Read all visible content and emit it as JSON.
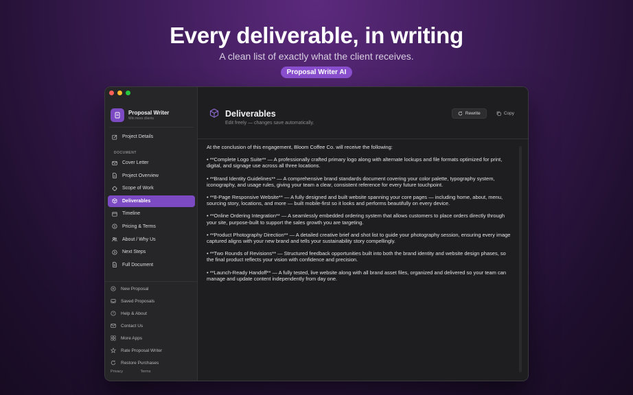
{
  "hero": {
    "title": "Every deliverable, in writing",
    "subtitle": "A clean list of exactly what the client receives.",
    "badge": "Proposal Writer AI"
  },
  "app": {
    "name": "Proposal Writer",
    "tagline": "Win more clients"
  },
  "sidebar": {
    "top_item": {
      "label": "Project Details",
      "icon": "edit-icon"
    },
    "section_label": "DOCUMENT",
    "items": [
      {
        "label": "Cover Letter",
        "icon": "envelope-icon"
      },
      {
        "label": "Project Overview",
        "icon": "document-icon"
      },
      {
        "label": "Scope of Work",
        "icon": "crosshair-icon"
      },
      {
        "label": "Deliverables",
        "icon": "cube-icon",
        "active": true
      },
      {
        "label": "Timeline",
        "icon": "calendar-icon"
      },
      {
        "label": "Pricing & Terms",
        "icon": "dollar-icon"
      },
      {
        "label": "About / Why Us",
        "icon": "people-icon"
      },
      {
        "label": "Next Steps",
        "icon": "arrow-circle-icon"
      },
      {
        "label": "Full Document",
        "icon": "full-document-icon"
      }
    ],
    "bottom_items": [
      {
        "label": "New Proposal",
        "icon": "plus-circle-icon"
      },
      {
        "label": "Saved Proposals",
        "icon": "tray-icon"
      },
      {
        "label": "Help & About",
        "icon": "question-icon"
      },
      {
        "label": "Contact Us",
        "icon": "mail-icon"
      },
      {
        "label": "More Apps",
        "icon": "grid-icon"
      },
      {
        "label": "Rate Proposal Writer",
        "icon": "star-icon"
      },
      {
        "label": "Restore Purchases",
        "icon": "restore-icon"
      }
    ],
    "footer": {
      "privacy": "Privacy",
      "terms": "Terms"
    }
  },
  "main": {
    "title": "Deliverables",
    "subtitle": "Edit freely — changes save automatically.",
    "rewrite_label": "Rewrite",
    "copy_label": "Copy",
    "paragraphs": [
      "At the conclusion of this engagement, Bloom Coffee Co. will receive the following:",
      "• **Complete Logo Suite** — A professionally crafted primary logo along with alternate lockups and file formats optimized for print, digital, and signage use across all three locations.",
      "• **Brand Identity Guidelines** — A comprehensive brand standards document covering your color palette, typography system, iconography, and usage rules, giving your team a clear, consistent reference for every future touchpoint.",
      "• **8-Page Responsive Website** — A fully designed and built website spanning your core pages — including home, about, menu, sourcing story, locations, and more — built mobile-first so it looks and performs beautifully on every device.",
      "• **Online Ordering Integration** — A seamlessly embedded ordering system that allows customers to place orders directly through your site, purpose-built to support the sales growth you are targeting.",
      "• **Product Photography Direction** — A detailed creative brief and shot list to guide your photography session, ensuring every image captured aligns with your new brand and tells your sustainability story compellingly.",
      "• **Two Rounds of Revisions** — Structured feedback opportunities built into both the brand identity and website design phases, so the final product reflects your vision with confidence and precision.",
      "• **Launch-Ready Handoff** — A fully tested, live website along with all brand asset files, organized and delivered so your team can manage and update content independently from day one."
    ]
  },
  "colors": {
    "accent": "#7c4bc4",
    "badge": "#8a4fcf"
  }
}
